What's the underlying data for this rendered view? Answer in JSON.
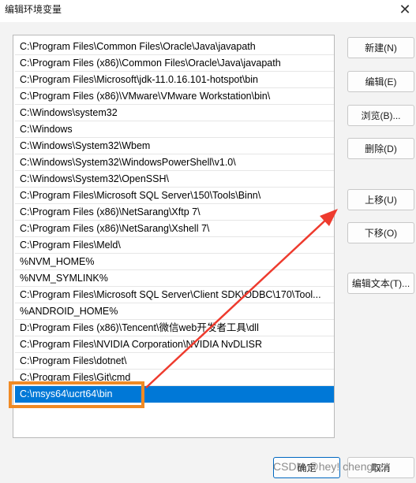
{
  "window": {
    "title": "编辑环境变量",
    "close_glyph": "✕"
  },
  "path_list": {
    "items": [
      "C:\\Program Files\\Common Files\\Oracle\\Java\\javapath",
      "C:\\Program Files (x86)\\Common Files\\Oracle\\Java\\javapath",
      "C:\\Program Files\\Microsoft\\jdk-11.0.16.101-hotspot\\bin",
      "C:\\Program Files (x86)\\VMware\\VMware Workstation\\bin\\",
      "C:\\Windows\\system32",
      "C:\\Windows",
      "C:\\Windows\\System32\\Wbem",
      "C:\\Windows\\System32\\WindowsPowerShell\\v1.0\\",
      "C:\\Windows\\System32\\OpenSSH\\",
      "C:\\Program Files\\Microsoft SQL Server\\150\\Tools\\Binn\\",
      "C:\\Program Files (x86)\\NetSarang\\Xftp 7\\",
      "C:\\Program Files (x86)\\NetSarang\\Xshell 7\\",
      "C:\\Program Files\\Meld\\",
      "%NVM_HOME%",
      "%NVM_SYMLINK%",
      "C:\\Program Files\\Microsoft SQL Server\\Client SDK\\ODBC\\170\\Tool...",
      "%ANDROID_HOME%",
      "D:\\Program Files (x86)\\Tencent\\微信web开发者工具\\dll",
      "C:\\Program Files\\NVIDIA Corporation\\NVIDIA NvDLISR",
      "C:\\Program Files\\dotnet\\",
      "C:\\Program Files\\Git\\cmd",
      "C:\\msys64\\ucrt64\\bin"
    ],
    "selected_index": 21
  },
  "side_buttons": {
    "new": "新建(N)",
    "edit": "编辑(E)",
    "browse": "浏览(B)...",
    "delete": "删除(D)",
    "move_up": "上移(U)",
    "move_down": "下移(O)",
    "edit_text": "编辑文本(T)..."
  },
  "footer": {
    "ok": "确定",
    "cancel": "取消"
  },
  "watermark": "CSDN @hey! chengzz",
  "colors": {
    "selection": "#0078d7",
    "highlight_box": "#f08a24",
    "arrow": "#ee3b2e"
  }
}
